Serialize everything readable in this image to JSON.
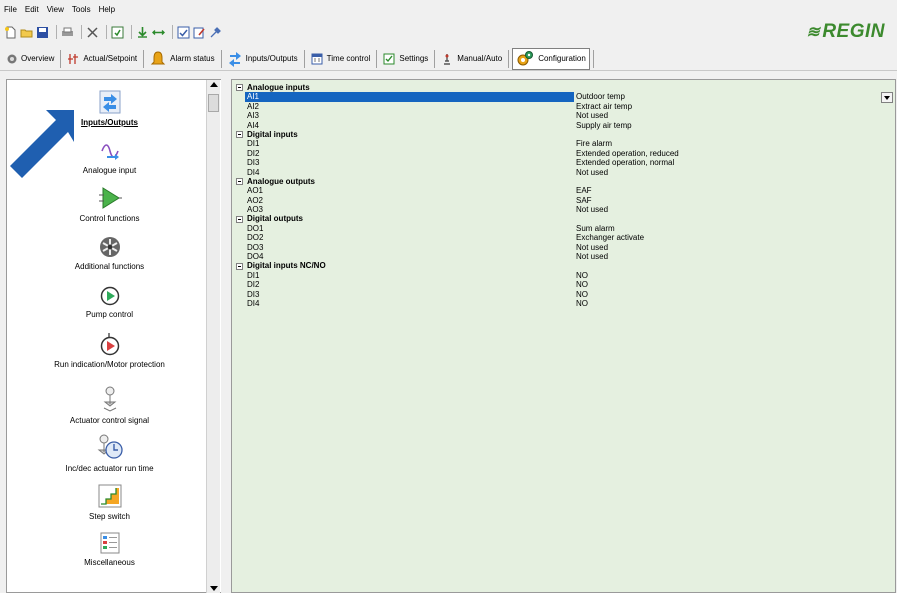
{
  "menu": [
    "File",
    "Edit",
    "View",
    "Tools",
    "Help"
  ],
  "brand": {
    "name": "REGIN",
    "color": "#3c8a2e"
  },
  "toolbar_icons": [
    "new-icon",
    "open-icon",
    "save-icon",
    "print-icon",
    "delete-icon",
    "refresh-icon",
    "download-icon",
    "transfer-icon",
    "check-icon",
    "edit-icon",
    "tool-icon"
  ],
  "tabs": [
    {
      "label": "Overview",
      "icon": "overview-icon"
    },
    {
      "label": "Actual/Setpoint",
      "icon": "setpoint-icon"
    },
    {
      "label": "Alarm status",
      "icon": "alarm-icon"
    },
    {
      "label": "Inputs/Outputs",
      "icon": "io-icon"
    },
    {
      "label": "Time control",
      "icon": "calendar-icon"
    },
    {
      "label": "Settings",
      "icon": "settings-icon"
    },
    {
      "label": "Manual/Auto",
      "icon": "manual-icon"
    },
    {
      "label": "Configuration",
      "icon": "configuration-icon"
    }
  ],
  "nav": [
    {
      "label": "Inputs/Outputs",
      "icon": "io-icon",
      "selected": true
    },
    {
      "label": "Analogue input",
      "icon": "analogue-input-icon"
    },
    {
      "label": "Control functions",
      "icon": "control-functions-icon"
    },
    {
      "label": "Additional functions",
      "icon": "fan-icon"
    },
    {
      "label": "Pump control",
      "icon": "pump-icon"
    },
    {
      "label": "Run indication/Motor protection",
      "icon": "motor-protection-icon"
    },
    {
      "label": "Actuator control signal",
      "icon": "actuator-icon"
    },
    {
      "label": "Inc/dec actuator run time",
      "icon": "actuator-runtime-icon"
    },
    {
      "label": "Step switch",
      "icon": "step-switch-icon"
    },
    {
      "label": "Miscellaneous",
      "icon": "miscellaneous-icon"
    }
  ],
  "groups": [
    {
      "title": "Analogue inputs",
      "rows": [
        {
          "name": "AI1",
          "value": "Outdoor temp",
          "selected": true
        },
        {
          "name": "AI2",
          "value": "Extract air temp"
        },
        {
          "name": "AI3",
          "value": "Not used"
        },
        {
          "name": "AI4",
          "value": "Supply air temp"
        }
      ]
    },
    {
      "title": "Digital inputs",
      "rows": [
        {
          "name": "DI1",
          "value": "Fire alarm"
        },
        {
          "name": "DI2",
          "value": "Extended operation, reduced"
        },
        {
          "name": "DI3",
          "value": "Extended operation, normal"
        },
        {
          "name": "DI4",
          "value": "Not used"
        }
      ]
    },
    {
      "title": "Analogue outputs",
      "rows": [
        {
          "name": "AO1",
          "value": "EAF"
        },
        {
          "name": "AO2",
          "value": "SAF"
        },
        {
          "name": "AO3",
          "value": "Not used"
        }
      ]
    },
    {
      "title": "Digital outputs",
      "rows": [
        {
          "name": "DO1",
          "value": "Sum alarm"
        },
        {
          "name": "DO2",
          "value": "Exchanger activate"
        },
        {
          "name": "DO3",
          "value": "Not used"
        },
        {
          "name": "DO4",
          "value": "Not used"
        }
      ]
    },
    {
      "title": "Digital inputs NC/NO",
      "rows": [
        {
          "name": "DI1",
          "value": "NO"
        },
        {
          "name": "DI2",
          "value": "NO"
        },
        {
          "name": "DI3",
          "value": "NO"
        },
        {
          "name": "DI4",
          "value": "NO"
        }
      ]
    }
  ],
  "colors": {
    "selection": "#1565c0",
    "panel_bg": "#e5f0e0",
    "arrow": "#1f5fb0"
  }
}
